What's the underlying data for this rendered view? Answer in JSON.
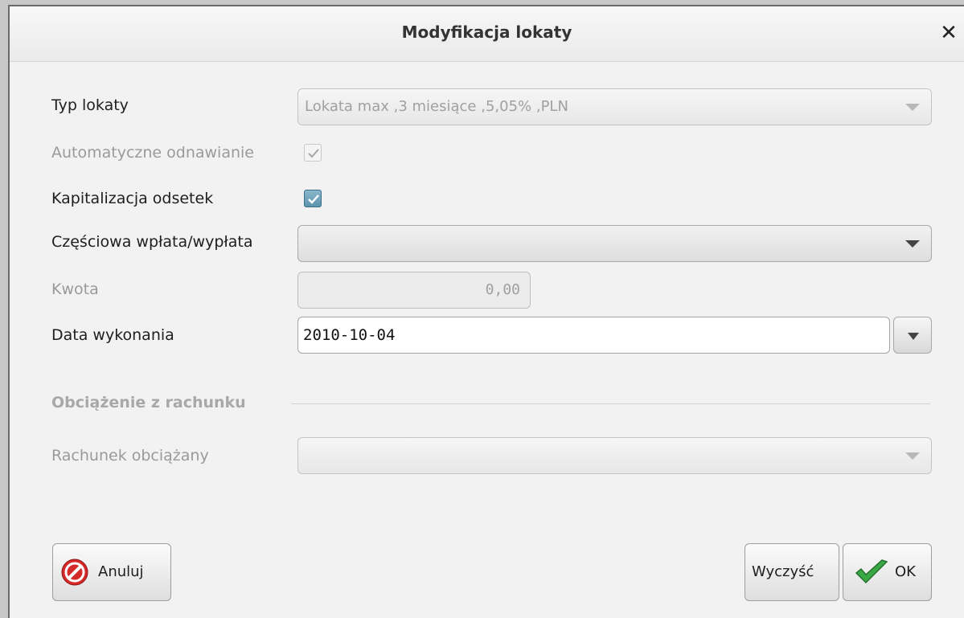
{
  "dialog": {
    "title": "Modyfikacja lokaty",
    "close_symbol": "✕"
  },
  "form": {
    "typ_lokaty": {
      "label": "Typ lokaty",
      "value": "Lokata max ,3 miesiące ,5,05% ,PLN"
    },
    "automatyczne_odnawianie": {
      "label": "Automatyczne odnawianie",
      "checked": true,
      "enabled": false
    },
    "kapitalizacja_odsetek": {
      "label": "Kapitalizacja odsetek",
      "checked": true,
      "enabled": true
    },
    "czesciowa_wplata": {
      "label": "Częściowa wpłata/wypłata",
      "value": ""
    },
    "kwota": {
      "label": "Kwota",
      "value": "0,00"
    },
    "data_wykonania": {
      "label": "Data wykonania",
      "value": "2010-10-04"
    },
    "section": {
      "title": "Obciążenie z rachunku"
    },
    "rachunek_obciazany": {
      "label": "Rachunek obciążany",
      "value": ""
    }
  },
  "buttons": {
    "anuluj": "Anuluj",
    "wyczysc": "Wyczyść",
    "ok": "OK"
  },
  "icons": {
    "cancel": "cancel-icon",
    "ok": "checkmark-icon",
    "close": "close-icon",
    "dropdown": "chevron-down-icon"
  },
  "colors": {
    "checkbox_active": "#5c93ae",
    "cancel_icon": "#d42a2a",
    "ok_icon": "#3aa845",
    "disabled_text": "#9a9a9a"
  }
}
